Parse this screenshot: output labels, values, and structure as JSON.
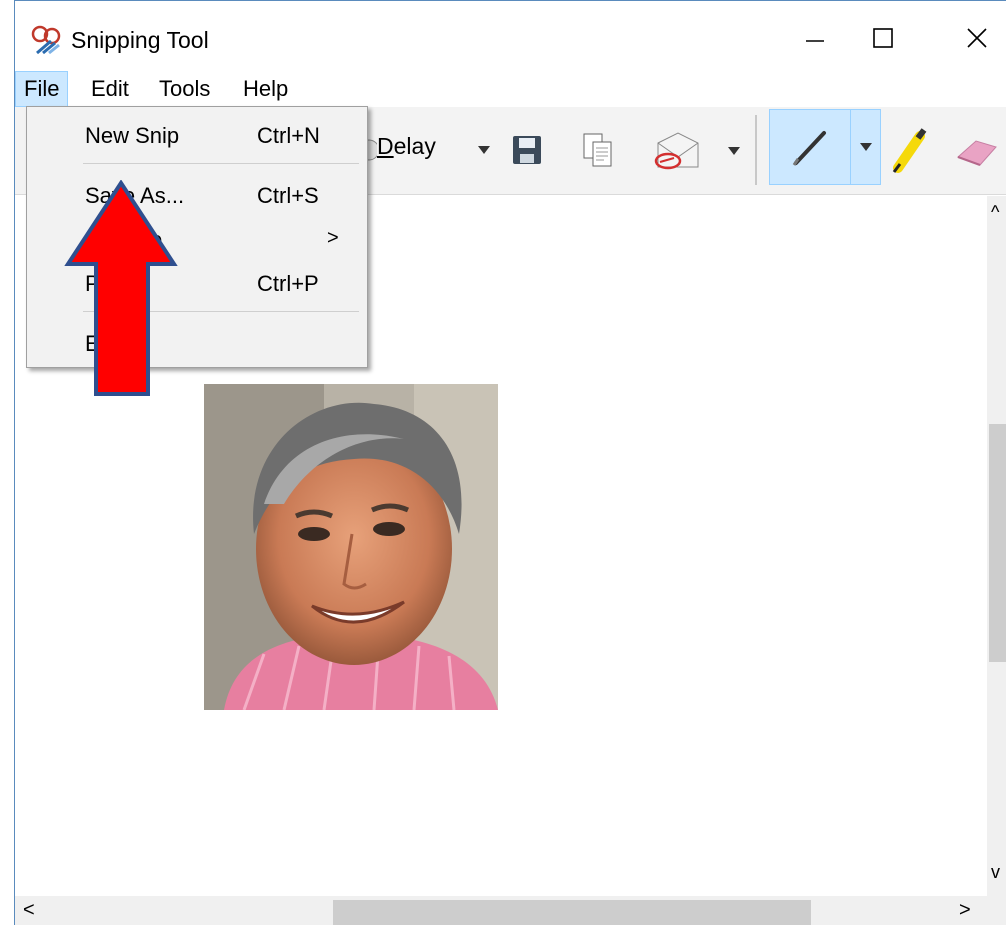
{
  "window": {
    "title": "Snipping Tool",
    "app_icon": "scissors-icon",
    "controls": {
      "minimize_icon": "minimize-icon",
      "maximize_icon": "maximize-icon",
      "close_icon": "close-icon"
    }
  },
  "menubar": {
    "items": [
      {
        "label": "File",
        "active": true
      },
      {
        "label": "Edit",
        "active": false
      },
      {
        "label": "Tools",
        "active": false
      },
      {
        "label": "Help",
        "active": false
      }
    ]
  },
  "toolbar": {
    "delay_label_underlined": "D",
    "delay_label_rest": "elay",
    "icons": [
      "save-icon",
      "copy-icon",
      "send-snip-icon",
      "pen-icon",
      "highlighter-icon",
      "eraser-icon"
    ],
    "accent": "#cce8ff"
  },
  "file_menu": {
    "items": [
      {
        "label": "New Snip",
        "shortcut": "Ctrl+N"
      },
      {
        "label": "Save As...",
        "shortcut": "Ctrl+S"
      },
      {
        "label": "S",
        "label_tail": "To",
        "submenu_arrow": ">"
      },
      {
        "label": "P",
        "shortcut": "Ctrl+P"
      },
      {
        "label": "E"
      }
    ]
  },
  "annotation": {
    "arrow_color": "#ff0000",
    "arrow_outline": "#2f4f8f",
    "icon": "up-arrow-icon"
  },
  "scrollbars": {
    "up": "^",
    "down": "v",
    "left": "<",
    "right": ">"
  }
}
